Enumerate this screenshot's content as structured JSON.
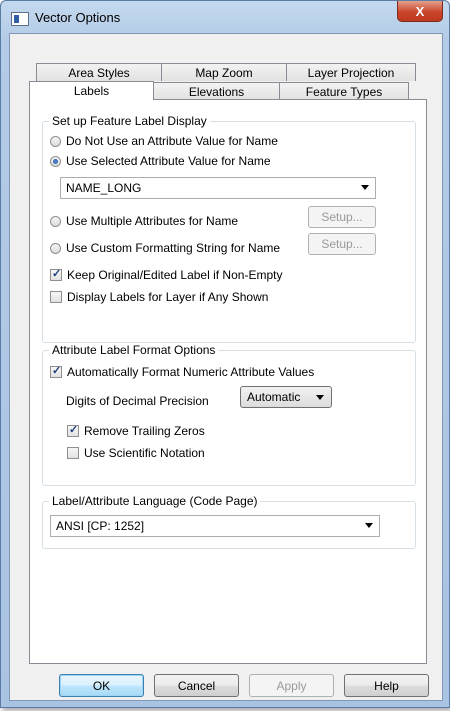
{
  "window": {
    "title": "Vector Options",
    "close_label": "X"
  },
  "tabs": {
    "row_back": [
      "Area Styles",
      "Map Zoom",
      "Layer Projection"
    ],
    "row_front": [
      "Labels",
      "Elevations",
      "Feature Types"
    ]
  },
  "label_display": {
    "legend": "Set up Feature Label Display",
    "opt_no_attr": "Do Not Use an Attribute Value for Name",
    "opt_selected_attr": "Use Selected Attribute Value for Name",
    "attribute_value": "NAME_LONG",
    "opt_multiple": "Use Multiple Attributes for Name",
    "opt_custom": "Use Custom Formatting String for Name",
    "setup_label": "Setup...",
    "keep_original": "Keep Original/Edited Label if Non-Empty",
    "display_if_any": "Display Labels for Layer if Any Shown"
  },
  "format_options": {
    "legend": "Attribute Label Format Options",
    "auto_format": "Automatically Format Numeric Attribute Values",
    "digits_label": "Digits of Decimal Precision",
    "digits_value": "Automatic",
    "remove_zeros": "Remove Trailing Zeros",
    "scientific": "Use Scientific Notation"
  },
  "language": {
    "legend": "Label/Attribute Language (Code Page)",
    "value": "ANSI [CP: 1252]"
  },
  "buttons": {
    "ok": "OK",
    "cancel": "Cancel",
    "apply": "Apply",
    "help": "Help"
  },
  "colors": {
    "title_bg": "#b9d1ea",
    "close_red": "#c9452b",
    "focus_blue": "#3c7fb1"
  }
}
